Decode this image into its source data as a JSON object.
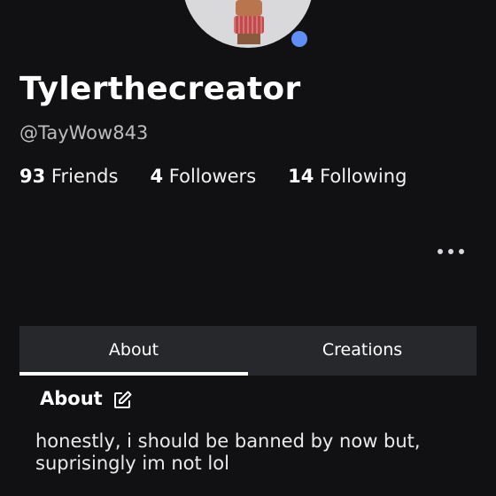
{
  "profile": {
    "display_name": "Tylerthecreator",
    "username": "@TayWow843",
    "online_status_color": "#5f8ef5"
  },
  "stats": [
    {
      "count": "93",
      "label": "Friends"
    },
    {
      "count": "4",
      "label": "Followers"
    },
    {
      "count": "14",
      "label": "Following"
    }
  ],
  "menu": {
    "icon": "more-horizontal-icon"
  },
  "tabs": [
    {
      "label": "About",
      "active": true
    },
    {
      "label": "Creations",
      "active": false
    }
  ],
  "about": {
    "title": "About",
    "edit_icon": "edit-icon",
    "text": "honestly, i should be banned by now but, suprisingly im not lol"
  }
}
